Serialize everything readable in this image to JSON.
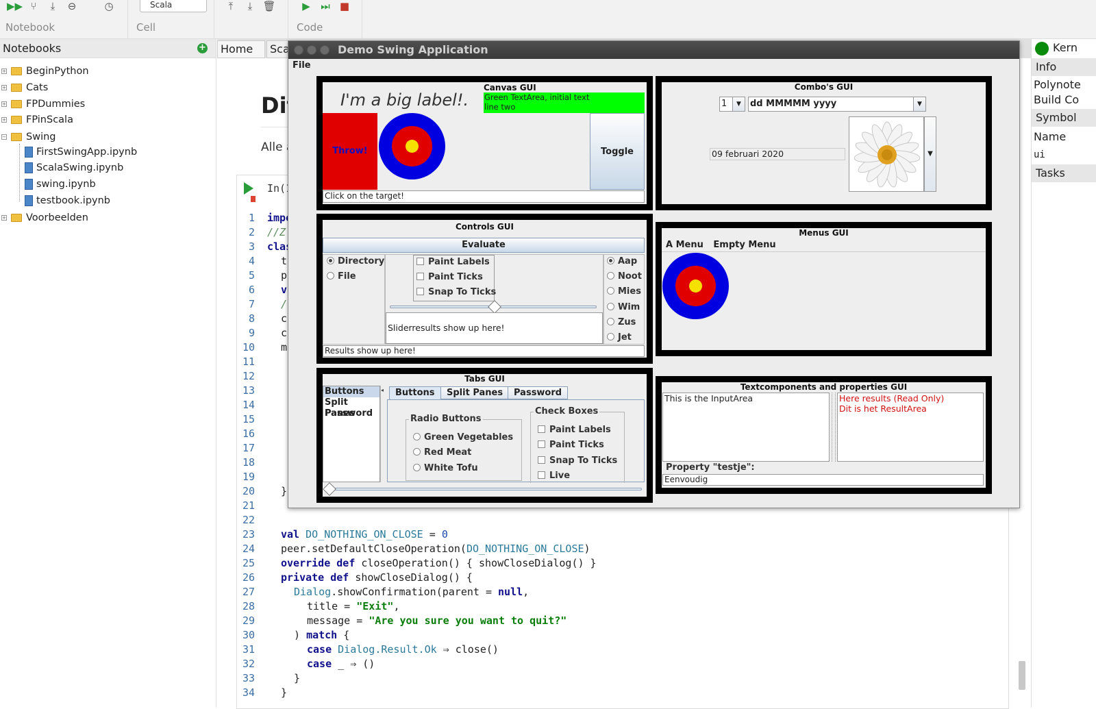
{
  "toolbar": {
    "groups": {
      "notebook": "Notebook",
      "cell": "Cell",
      "code": "Code"
    },
    "cell_type": "Scala",
    "icons": [
      "run-all-icon",
      "branch-icon",
      "download-icon",
      "minus-circle-icon",
      "clock-icon",
      "arrow-up-icon",
      "arrow-down-icon",
      "trash-icon",
      "run-icon",
      "fast-forward-icon",
      "stop-icon"
    ]
  },
  "notebooks_panel": {
    "title": "Notebooks",
    "folders": [
      "BeginPython",
      "Cats",
      "FPDummies",
      "FPinScala",
      "Swing",
      "Voorbeelden"
    ],
    "swing_files": [
      "FirstSwingApp.ipynb",
      "ScalaSwing.ipynb",
      "swing.ipynb",
      "testbook.ipynb"
    ]
  },
  "editor": {
    "tabs": [
      "Home",
      "Sca"
    ],
    "doc_title": "Dit",
    "doc_para": "Alle a",
    "in_label": "In(1",
    "line_numbers": [
      "1",
      "2",
      "3",
      "4",
      "5",
      "6",
      "7",
      "8",
      "9",
      "10",
      "11",
      "12",
      "13",
      "14",
      "15",
      "16",
      "17",
      "18",
      "19",
      "20",
      "21",
      "22",
      "23",
      "24",
      "25",
      "26",
      "27",
      "28",
      "29",
      "30",
      "31",
      "32",
      "33",
      "34"
    ],
    "partial_lines": {
      "l1": "impo",
      "l2": "//Z",
      "l3": "clas",
      "l4": "t",
      "l5": "p",
      "l6": "v",
      "l7": "/",
      "l8": "c",
      "l9": "c",
      "l10": "m",
      "l20": "}"
    },
    "code": {
      "l23_kw": "val",
      "l23_name": "DO_NOTHING_ON_CLOSE",
      "l23_rest": " = ",
      "l23_num": "0",
      "l24_a": "peer.setDefaultCloseOperation(",
      "l24_b": "DO_NOTHING_ON_CLOSE",
      "l24_c": ")",
      "l25_kw1": "override",
      "l25_kw2": "def",
      "l25_rest": " closeOperation() { showCloseDialog() }",
      "l26_kw1": "private",
      "l26_kw2": "def",
      "l26_rest": " showCloseDialog() {",
      "l27_tp": "Dialog",
      "l27_rest": ".showConfirmation(parent = ",
      "l27_kw": "null",
      "l27_end": ",",
      "l28_a": "title = ",
      "l28_str": "\"Exit\"",
      "l28_end": ",",
      "l29_a": "message = ",
      "l29_str": "\"Are you sure you want to quit?\"",
      "l30_a": ") ",
      "l30_kw": "match",
      "l30_end": " {",
      "l31_kw": "case",
      "l31_tp": "Dialog.Result.Ok",
      "l31_rest": " ⇒ close()",
      "l32_kw": "case",
      "l32_rest": " _ ⇒ ()",
      "l33": "}",
      "l34": "}"
    }
  },
  "right_panel": {
    "kernel": "Kern",
    "info": "Info",
    "polynote": "Polynote",
    "build": "Build Co",
    "symbol": "Symbol",
    "name": "Name",
    "ui": "ui",
    "tasks": "Tasks"
  },
  "swing": {
    "title": "Demo Swing Application",
    "menu_file": "File",
    "canvas": {
      "title": "Canvas GUI",
      "big_label": "I'm a big label!.",
      "green_text_1": "Green TextArea, initial text",
      "green_text_2": "line two",
      "throw": "Throw!",
      "toggle": "Toggle",
      "status": "Click on the target!"
    },
    "combos": {
      "title": "Combo's GUI",
      "num": "1",
      "format": "dd MMMMM yyyy",
      "date": "09 februari 2020"
    },
    "controls": {
      "title": "Controls GUI",
      "evaluate": "Evaluate",
      "radios_left": [
        "Directory",
        "File"
      ],
      "checks": [
        "Paint Labels",
        "Paint Ticks",
        "Snap To Ticks"
      ],
      "slider_result": "Sliderresults show up here!",
      "radios_right": [
        "Aap",
        "Noot",
        "Mies",
        "Wim",
        "Zus",
        "Jet"
      ],
      "results": "Results show up here!"
    },
    "menus": {
      "title": "Menus GUI",
      "items": [
        "A Menu",
        "Empty Menu"
      ]
    },
    "tabs_gui": {
      "title": "Tabs GUI",
      "list": [
        "Buttons",
        "Split Panes",
        "Password"
      ],
      "tabs": [
        "Buttons",
        "Split Panes",
        "Password"
      ],
      "radio_group": "Radio Buttons",
      "radios": [
        "Green Vegetables",
        "Red Meat",
        "White Tofu"
      ],
      "check_group": "Check Boxes",
      "checks": [
        "Paint Labels",
        "Paint Ticks",
        "Snap To Ticks",
        "Live"
      ]
    },
    "text_gui": {
      "title": "Textcomponents and properties GUI",
      "input": "This is the InputArea",
      "result_1": "Here results (Read Only)",
      "result_2": "Dit is het ResultArea",
      "prop_label": "Property \"testje\":",
      "prop_value": "Eenvoudig"
    },
    "colors": {
      "target_outer": "#0000e0",
      "target_mid": "#e00000",
      "target_inner": "#f5e000",
      "throw_bg": "#e00000",
      "green_area": "#00ff00"
    }
  }
}
